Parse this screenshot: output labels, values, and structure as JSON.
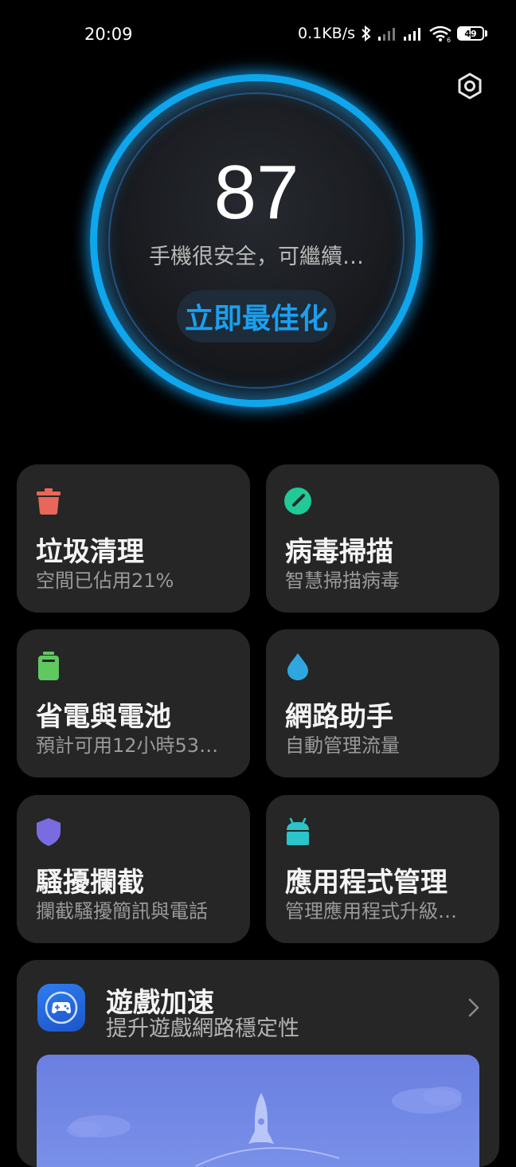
{
  "status_bar": {
    "time": "20:09",
    "net_speed": "0.1KB/s",
    "battery_level": "49",
    "icons": [
      "bluetooth-icon",
      "signal-icon",
      "signal-icon",
      "wifi-icon",
      "battery-icon"
    ]
  },
  "header": {
    "settings_icon": "gear-icon"
  },
  "score": {
    "value": "87",
    "status": "手機很安全，可繼續…",
    "button_label": "立即最佳化",
    "ring_color": "#0fa6ec"
  },
  "cards": [
    {
      "title": "垃圾清理",
      "subtitle": "空間已佔用21%",
      "icon": "trash-icon",
      "color": "#e8675a"
    },
    {
      "title": "病毒掃描",
      "subtitle": "智慧掃描病毒",
      "icon": "scan-icon",
      "color": "#20c997"
    },
    {
      "title": "省電與電池",
      "subtitle": "預計可用12小時53…",
      "icon": "battery-icon",
      "color": "#5fc861"
    },
    {
      "title": "網路助手",
      "subtitle": "自動管理流量",
      "icon": "drop-icon",
      "color": "#2ea7e0"
    },
    {
      "title": "騷擾攔截",
      "subtitle": "攔截騷擾簡訊與電話",
      "icon": "shield-icon",
      "color": "#7b6be0"
    },
    {
      "title": "應用程式管理",
      "subtitle": "管理應用程式升級…",
      "icon": "android-icon",
      "color": "#2bc4c8"
    }
  ],
  "game_boost": {
    "title": "遊戲加速",
    "subtitle": "提升遊戲網路穩定性",
    "icon": "gamepad-icon"
  }
}
